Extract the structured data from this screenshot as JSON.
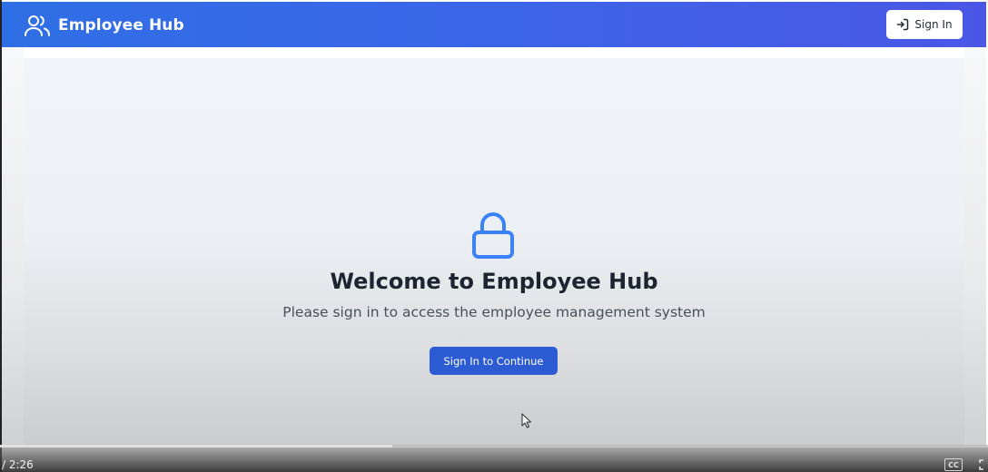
{
  "app": {
    "title": "Employee Hub",
    "brand_icon": "users-icon",
    "accent_color": "#2f6fe6"
  },
  "header": {
    "signin_label": "Sign In",
    "signin_icon": "log-in-icon"
  },
  "main": {
    "icon": "lock-icon",
    "title": "Welcome to Employee Hub",
    "subtitle": "Please sign in to access the employee management system",
    "cta_label": "Sign In to Continue",
    "cta_color": "#2d5bd3"
  },
  "video_player": {
    "time_text": "/ 2:26",
    "progress_fraction": 0.397,
    "cc_label": "CC",
    "fullscreen_icon": "fullscreen-icon"
  }
}
